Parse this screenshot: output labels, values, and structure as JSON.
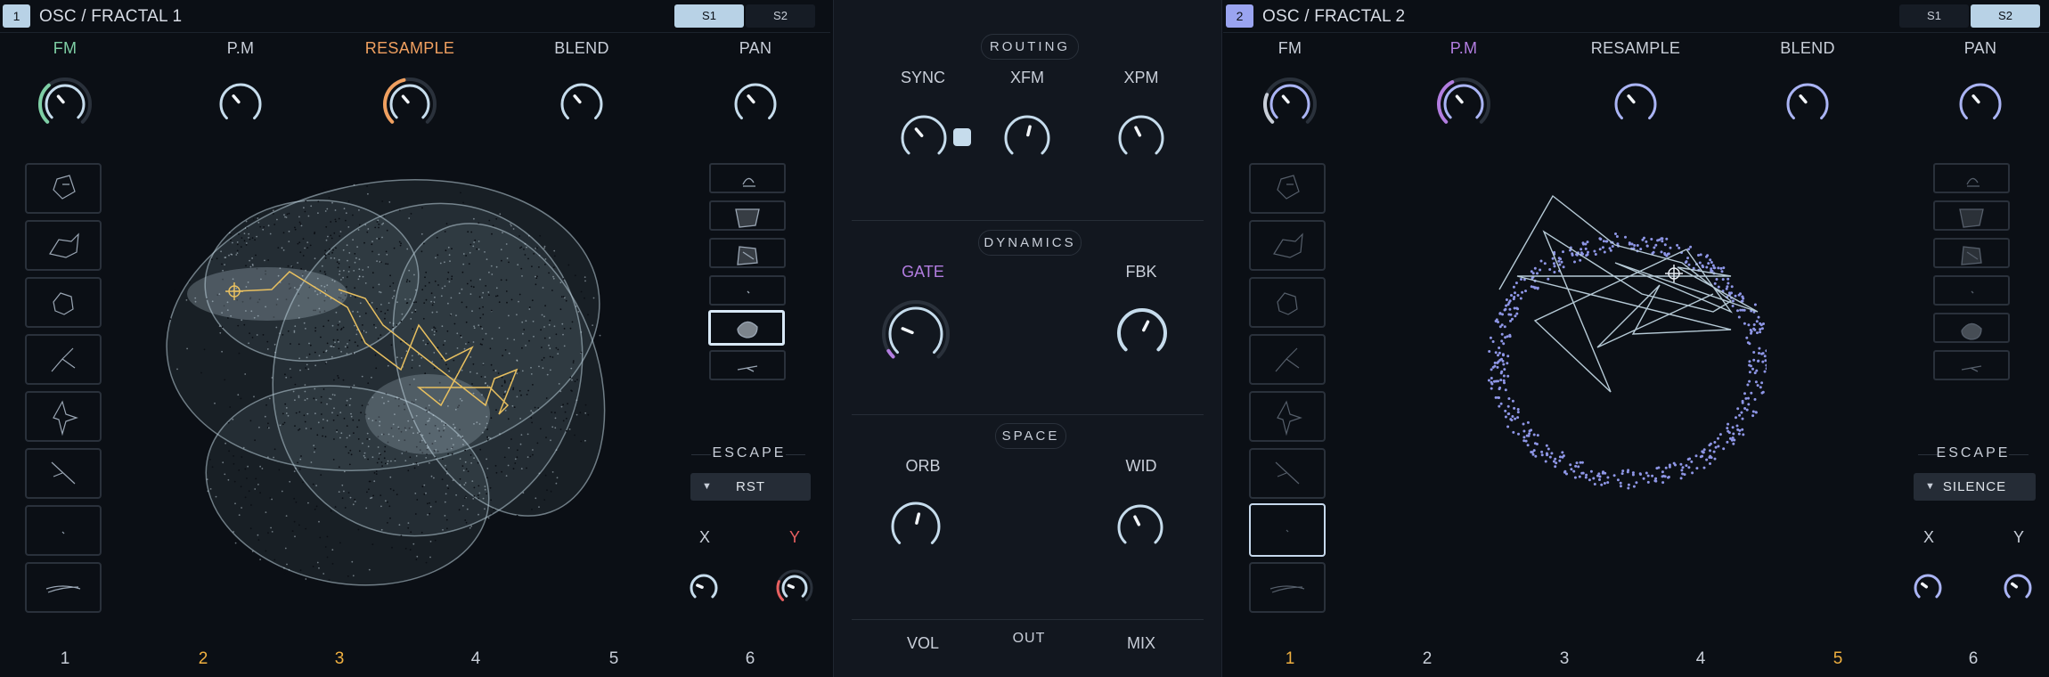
{
  "colors": {
    "accent_ice": "#c6dcec",
    "accent_green": "#7ecfa5",
    "accent_orange": "#f0a060",
    "accent_purple": "#b27de0",
    "accent_periwinkle": "#9aa4f0",
    "accent_red": "#e86060",
    "accent_gold": "#f0b040",
    "attractor_path": "#e8c060"
  },
  "osc1": {
    "number": "1",
    "title": "OSC / FRACTAL 1",
    "tabs": [
      "S1",
      "S2"
    ],
    "active_tab": "S1",
    "knobs": [
      {
        "label": "FM",
        "value": 0.35,
        "color": "#7ecfa5"
      },
      {
        "label": "P.M",
        "value": 0.0,
        "color": "#c8ced8"
      },
      {
        "label": "RESAMPLE",
        "value": 0.45,
        "color": "#f0a060"
      },
      {
        "label": "BLEND",
        "value": 0.0,
        "color": "#c8ced8"
      },
      {
        "label": "PAN",
        "value": 0.0,
        "color": "#c8ced8"
      }
    ],
    "fractal_list": [
      "fractal-1-icon",
      "fractal-2-icon",
      "fractal-3-icon",
      "fractal-4-icon",
      "fractal-5-icon",
      "fractal-6-icon",
      "fractal-7-icon",
      "fractal-8-icon"
    ],
    "mini_presets": [
      "mini-1",
      "mini-2",
      "mini-3",
      "mini-4",
      "mini-5",
      "mini-6"
    ],
    "mini_selected": 4,
    "escape": {
      "label": "ESCAPE",
      "value": "RST"
    },
    "x_label": "X",
    "y_label": "Y",
    "slots": [
      "1",
      "2",
      "3",
      "4",
      "5",
      "6"
    ],
    "slot_highlight": [
      1,
      2
    ]
  },
  "mid": {
    "routing": {
      "title": "ROUTING",
      "knobs": [
        {
          "label": "SYNC",
          "value": 0.0
        },
        {
          "label": "XFM",
          "value": 0.0
        },
        {
          "label": "XPM",
          "value": 0.0
        }
      ]
    },
    "dynamics": {
      "title": "DYNAMICS",
      "knobs": [
        {
          "label": "GATE",
          "value": 0.05
        },
        {
          "label": "FBK",
          "value": 0.0
        }
      ]
    },
    "space": {
      "title": "SPACE",
      "knobs": [
        {
          "label": "ORB",
          "value": 0.0
        },
        {
          "label": "WID",
          "value": 0.0
        }
      ]
    },
    "out": {
      "title": "OUT",
      "vol": "VOL",
      "mix": "MIX"
    }
  },
  "osc2": {
    "number": "2",
    "title": "OSC / FRACTAL 2",
    "tabs": [
      "S1",
      "S2"
    ],
    "active_tab": "S2",
    "knobs": [
      {
        "label": "FM",
        "value": 0.25,
        "color": "#c8ced8"
      },
      {
        "label": "P.M",
        "value": 0.4,
        "color": "#b27de0"
      },
      {
        "label": "RESAMPLE",
        "value": 0.0,
        "color": "#c8ced8"
      },
      {
        "label": "BLEND",
        "value": 0.0,
        "color": "#c8ced8"
      },
      {
        "label": "PAN",
        "value": 0.0,
        "color": "#c8ced8"
      }
    ],
    "fractal_list": [
      "fractal-1-icon",
      "fractal-2-icon",
      "fractal-3-icon",
      "fractal-4-icon",
      "fractal-5-icon",
      "fractal-6-icon",
      "fractal-7-icon",
      "fractal-8-icon"
    ],
    "fractal_selected": 6,
    "mini_presets": [
      "mini-1",
      "mini-2",
      "mini-3",
      "mini-4",
      "mini-5",
      "mini-6"
    ],
    "escape": {
      "label": "ESCAPE",
      "value": "SILENCE"
    },
    "x_label": "X",
    "y_label": "Y",
    "slots": [
      "1",
      "2",
      "3",
      "4",
      "5",
      "6"
    ],
    "slot_highlight": [
      0,
      4
    ]
  }
}
